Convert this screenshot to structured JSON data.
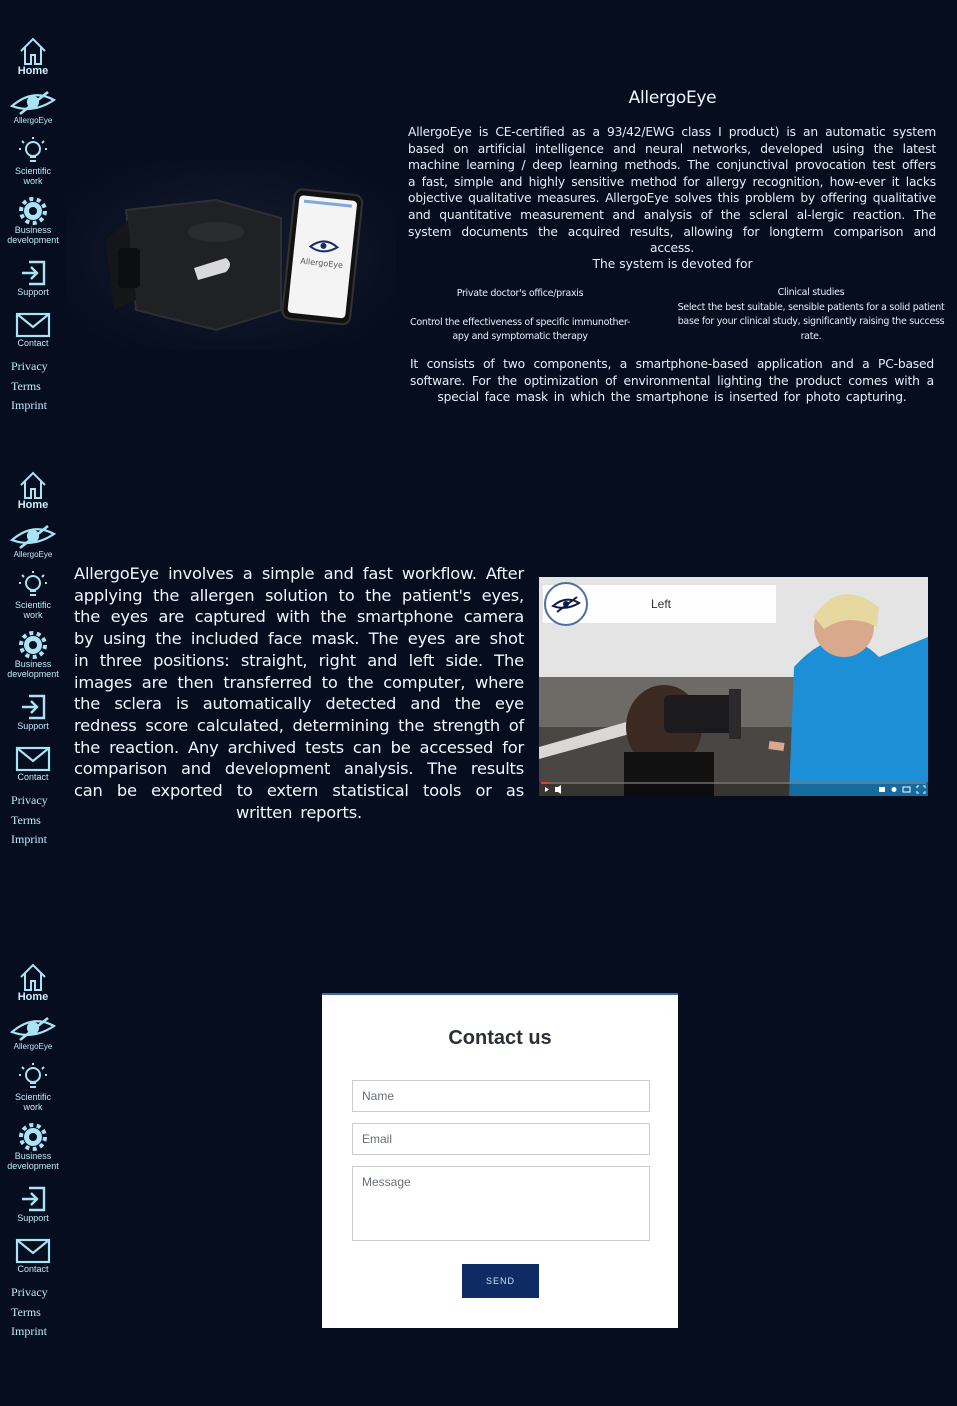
{
  "nav": {
    "items": [
      {
        "label": "Home",
        "icon": "home-icon"
      },
      {
        "label": "AllergoEye",
        "icon": "eye-logo-icon"
      },
      {
        "label1": "Scientific",
        "label2": "work",
        "icon": "lightbulb-icon"
      },
      {
        "label1": "Business",
        "label2": "development",
        "icon": "gear-icon"
      },
      {
        "label": "Support",
        "icon": "sign-in-icon"
      },
      {
        "label": "Contact",
        "icon": "envelope-icon"
      }
    ],
    "legal": [
      "Privacy",
      "Terms",
      "Imprint"
    ]
  },
  "section1": {
    "title": "AllergoEye",
    "intro": "AllergoEye is CE-certified as a 93/42/EWG class I product) is an automatic system based on artificial intelligence and neural networks, developed using the latest machine learning / deep learning methods. The conjunctival provocation test offers a fast, simple and highly sensitive method for allergy recognition, how-ever it lacks objective qualitative measures. AllergoEye solves this problem by offering qualitative and quantitative measurement and analysis of the scleral al-lergic reaction. The system documents the acquired results, allowing for longterm comparison and access.",
    "devoted": "The system is devoted for",
    "col1_head": "Private doctor's office/praxis",
    "col1_text": "Control the effectiveness of specific immunother-apy and symptomatic therapy",
    "col2_head": "Clinical studies",
    "col2_text": "Select the best suitable, sensible patients for a solid patient base for your clinical study, significantly raising the success rate.",
    "components": "It consists of two components, a smartphone-based application and a PC-based software. For the optimization of environmental lighting the product comes with a special face mask in which the smartphone is inserted for photo capturing.",
    "phone_app_label": "AllergoEye"
  },
  "section2": {
    "workflow": "AllergoEye involves a simple and fast workflow. After applying the allergen solution to the patient's eyes, the eyes are captured with the smartphone camera by using the included face mask. The eyes are shot in three positions: straight, right and left side. The images are then transferred to the computer, where the sclera is automatically detected and the eye redness score calculated, determining the strength of the reaction. Any archived tests can be accessed for comparison and development analysis. The results can be exported to extern statistical tools or as written reports.",
    "video_banner": "Left",
    "video_progress": 0.02
  },
  "contact": {
    "title": "Contact us",
    "name_placeholder": "Name",
    "email_placeholder": "Email",
    "message_placeholder": "Message",
    "send_label": "SEND"
  }
}
